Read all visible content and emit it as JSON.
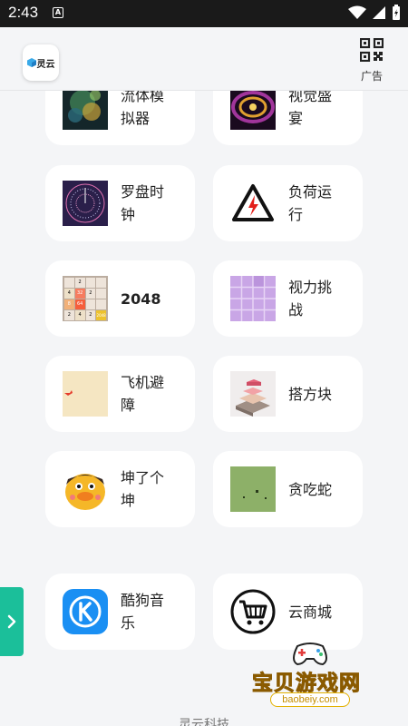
{
  "status_bar": {
    "time": "2:43",
    "notification_letter": "A"
  },
  "header": {
    "logo_text": "灵云",
    "ad_label": "广告"
  },
  "apps": [
    {
      "id": "fluid",
      "label": "流体模\n拟器"
    },
    {
      "id": "visual",
      "label": "视觉盛\n宴"
    },
    {
      "id": "clock",
      "label": "罗盘时\n钟"
    },
    {
      "id": "load",
      "label": "负荷运\n行"
    },
    {
      "id": "2048",
      "label": "2048"
    },
    {
      "id": "vision",
      "label": "视力挑\n战"
    },
    {
      "id": "plane",
      "label": "飞机避\n障"
    },
    {
      "id": "stack",
      "label": "搭方块"
    },
    {
      "id": "kun",
      "label": "坤了个\n坤"
    },
    {
      "id": "snake",
      "label": "贪吃蛇"
    },
    {
      "id": "kugou",
      "label": "酷狗音\n乐"
    },
    {
      "id": "shop",
      "label": "云商城"
    }
  ],
  "game_2048_tiles": [
    "",
    "2",
    "",
    "",
    "4",
    "32",
    "2",
    "",
    "8",
    "64",
    "",
    "",
    "2",
    "4",
    "2",
    "2048"
  ],
  "footer": {
    "text": "灵云科技"
  },
  "watermark": {
    "text": "宝贝游戏网",
    "url": "baobeiy.com"
  },
  "colors": {
    "accent": "#1bbf9a",
    "card": "#ffffff",
    "background": "#f4f5f7"
  }
}
